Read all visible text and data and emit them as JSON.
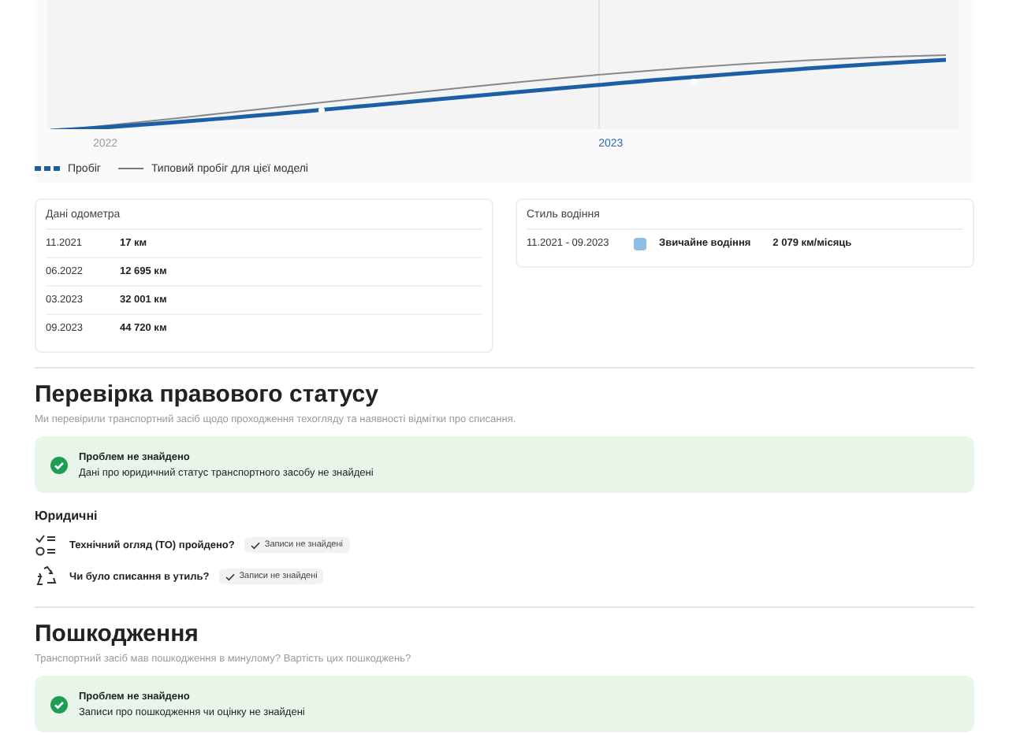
{
  "chart": {
    "x_labels": [
      {
        "label": "2022",
        "highlighted": false
      },
      {
        "label": "2023",
        "highlighted": true
      }
    ],
    "legend": [
      {
        "label": "Пробіг",
        "kind": "dashed"
      },
      {
        "label": "Типовий пробіг для цієї моделі",
        "kind": "thin"
      }
    ]
  },
  "odometer": {
    "title": "Дані одометра",
    "rows": [
      {
        "date": "11.2021",
        "value": "17 км"
      },
      {
        "date": "06.2022",
        "value": "12 695 км"
      },
      {
        "date": "03.2023",
        "value": "32 001 км"
      },
      {
        "date": "09.2023",
        "value": "44 720 км"
      }
    ]
  },
  "driving_style": {
    "title": "Стиль водіння",
    "rows": [
      {
        "period": "11.2021 - 09.2023",
        "style": "Звичайне водіння",
        "color": "#8dbfe8",
        "rate": "2 079 км/місяць"
      }
    ]
  },
  "legal": {
    "title": "Перевірка правового статусу",
    "subtitle": "Ми перевірили транспортний засіб щодо проходження техогляду та наявності відмітки про списання.",
    "notice": {
      "title": "Проблем не знайдено",
      "text": "Дані про юридичний статус транспортного засобу не знайдені"
    },
    "group_title": "Юридичні",
    "checks": [
      {
        "kind": "inspection",
        "question": "Технічний огляд (ТО) пройдено?",
        "result": "Записи не знайдені"
      },
      {
        "kind": "recycling",
        "question": "Чи було списання в утиль?",
        "result": "Записи не знайдені"
      }
    ]
  },
  "damage": {
    "title": "Пошкодження",
    "subtitle": "Транспортний засіб мав пошкодження в минулому? Вартість цих пошкоджень?",
    "notice": {
      "title": "Проблем не знайдено",
      "text": "Записи про пошкодження чи оцінку не знайдені"
    }
  }
}
